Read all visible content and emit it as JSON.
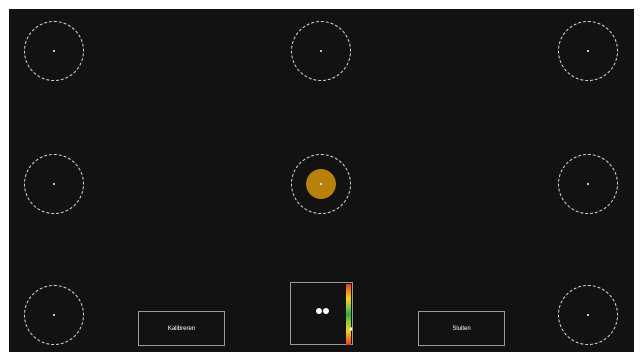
{
  "buttons": {
    "calibrate_label": "Kalibreren",
    "close_label": "Sluiten"
  },
  "targets": [
    {
      "id": "top-left",
      "active": false
    },
    {
      "id": "top-center",
      "active": false
    },
    {
      "id": "top-right",
      "active": false
    },
    {
      "id": "middle-left",
      "active": false
    },
    {
      "id": "middle-center",
      "active": true
    },
    {
      "id": "middle-right",
      "active": false
    },
    {
      "id": "bottom-left",
      "active": false
    },
    {
      "id": "bottom-right",
      "active": false
    }
  ],
  "colors": {
    "background": "#121212",
    "gaze_marker": "#b8800c",
    "target_outline": "#d8d8d8"
  },
  "eye_tracker_status": {
    "eyes_detected": 2,
    "distance_level": 0.74
  }
}
